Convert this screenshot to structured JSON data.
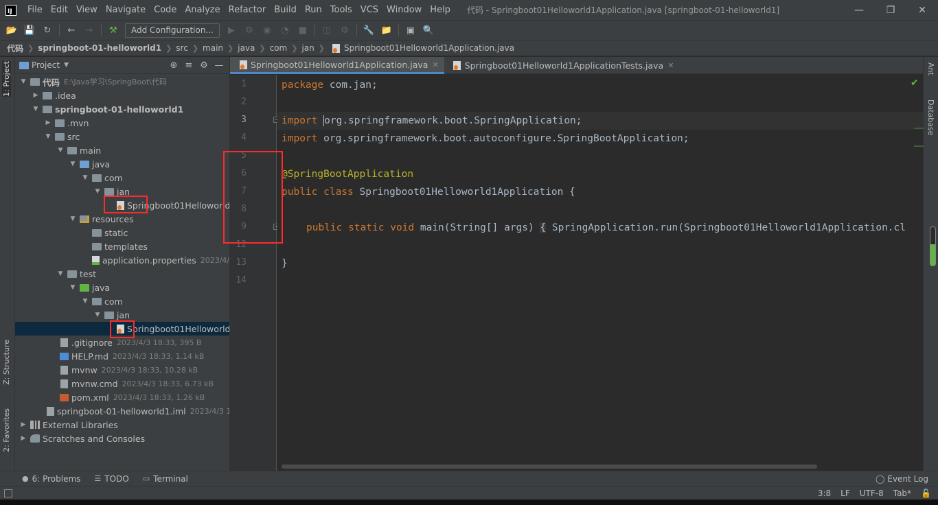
{
  "app": {
    "logo_text": "IJ",
    "window_title": "代码 - Springboot01Helloworld1Application.java [springboot-01-helloworld1]",
    "menu": [
      "File",
      "Edit",
      "View",
      "Navigate",
      "Code",
      "Analyze",
      "Refactor",
      "Build",
      "Run",
      "Tools",
      "VCS",
      "Window",
      "Help"
    ]
  },
  "toolbar": {
    "add_configuration": "Add Configuration..."
  },
  "breadcrumb": [
    "代码",
    "springboot-01-helloworld1",
    "src",
    "main",
    "java",
    "com",
    "jan",
    "Springboot01Helloworld1Application.java"
  ],
  "left_tabs": {
    "project": "1: Project",
    "structure": "Z: Structure",
    "favorites": "2: Favorites"
  },
  "right_tabs": {
    "ant": "Ant",
    "database": "Database"
  },
  "project_panel": {
    "title": "Project",
    "tree": [
      {
        "label": "代码",
        "meta": "E:\\Java学习\\SpringBoot\\代码",
        "bold": true
      },
      {
        "label": ".idea",
        "meta": ""
      },
      {
        "label": "springboot-01-helloworld1",
        "meta": "",
        "bold": true
      },
      {
        "label": ".mvn",
        "meta": ""
      },
      {
        "label": "src",
        "meta": ""
      },
      {
        "label": "main",
        "meta": ""
      },
      {
        "label": "java",
        "meta": ""
      },
      {
        "label": "com",
        "meta": ""
      },
      {
        "label": "jan",
        "meta": ""
      },
      {
        "label": "Springboot01Helloworld",
        "meta": ""
      },
      {
        "label": "resources",
        "meta": ""
      },
      {
        "label": "static",
        "meta": ""
      },
      {
        "label": "templates",
        "meta": ""
      },
      {
        "label": "application.properties",
        "meta": "2023/4/3"
      },
      {
        "label": "test",
        "meta": ""
      },
      {
        "label": "java",
        "meta": ""
      },
      {
        "label": "com",
        "meta": ""
      },
      {
        "label": "jan",
        "meta": ""
      },
      {
        "label": "Springboot01Helloworld",
        "meta": ""
      },
      {
        "label": ".gitignore",
        "meta": "2023/4/3 18:33, 395 B"
      },
      {
        "label": "HELP.md",
        "meta": "2023/4/3 18:33, 1.14 kB"
      },
      {
        "label": "mvnw",
        "meta": "2023/4/3 18:33, 10.28 kB"
      },
      {
        "label": "mvnw.cmd",
        "meta": "2023/4/3 18:33, 6.73 kB"
      },
      {
        "label": "pom.xml",
        "meta": "2023/4/3 18:33, 1.26 kB"
      },
      {
        "label": "springboot-01-helloworld1.iml",
        "meta": "2023/4/3 18:3"
      },
      {
        "label": "External Libraries",
        "meta": ""
      },
      {
        "label": "Scratches and Consoles",
        "meta": ""
      }
    ]
  },
  "editor": {
    "tabs": [
      {
        "label": "Springboot01Helloworld1Application.java"
      },
      {
        "label": "Springboot01Helloworld1ApplicationTests.java"
      }
    ],
    "line_numbers": [
      "1",
      "2",
      "3",
      "4",
      "5",
      "6",
      "7",
      "8",
      "9",
      "12",
      "13",
      "14"
    ],
    "code": {
      "l1_kw": "package",
      "l1_rest": " com.jan;",
      "l3_kw": "import",
      "l3_rest": "org.springframework.boot.SpringApplication;",
      "l4_kw": "import",
      "l4_rest": " org.springframework.boot.autoconfigure.SpringBootApplication;",
      "l6_ann": "@SpringBootApplication",
      "l7_kw": "public class",
      "l7_rest": " Springboot01Helloworld1Application {",
      "l9_kw": "public static void",
      "l9_sig": " main(String[] args) ",
      "l9_fold_open": "{",
      "l9_body": " SpringApplication.run(Springboot01Helloworld1Application.cl",
      "l12": "}"
    }
  },
  "tool_windows": {
    "problems": "6: Problems",
    "todo": "TODO",
    "terminal": "Terminal",
    "event_log": "Event Log"
  },
  "status": {
    "position": "3:8",
    "line_sep": "LF",
    "encoding": "UTF-8",
    "indent": "Tab*"
  }
}
